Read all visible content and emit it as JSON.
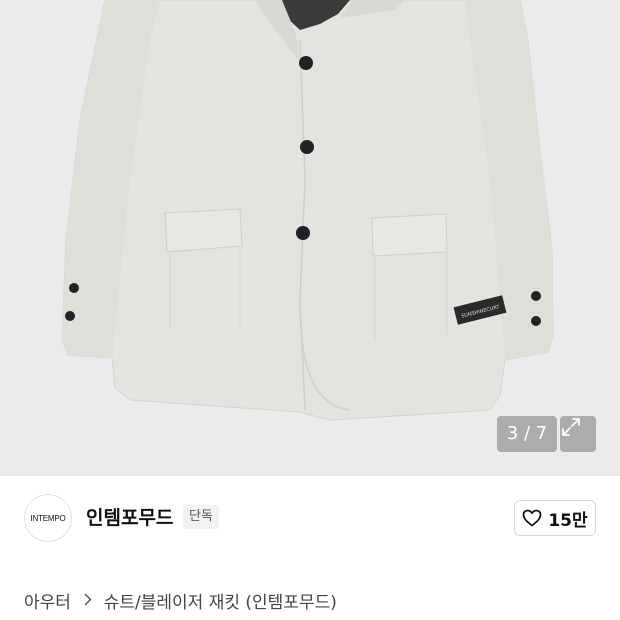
{
  "gallery": {
    "counter": "3 / 7",
    "label_text": "SUNSHINECURT",
    "icons": {
      "expand": "expand-icon"
    }
  },
  "brand": {
    "logo_text": "INTEMPO",
    "name": "인템포무드",
    "badge": "단독",
    "like_count": "15만",
    "icons": {
      "like": "heart-outline-icon"
    }
  },
  "breadcrumb": {
    "items": [
      "아우터",
      "슈트/블레이저 재킷 (인템포무드)"
    ],
    "separator_icon": "chevron-right-icon"
  },
  "colors": {
    "image_background": "#ebebeb",
    "jacket": "#e4e3df",
    "badge_background": "#f1f2f4",
    "text": "#111111"
  }
}
